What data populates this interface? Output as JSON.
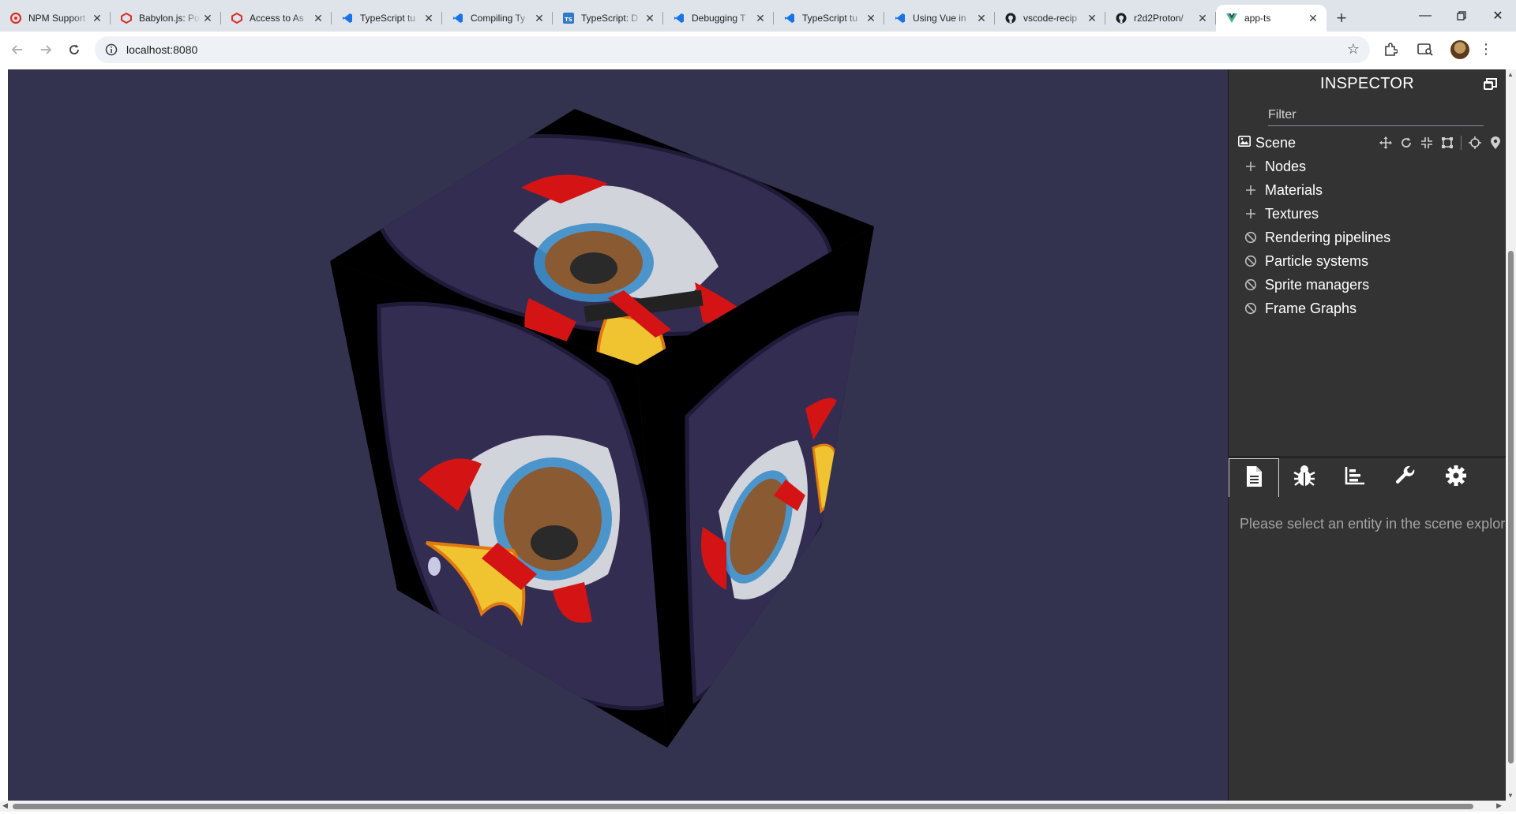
{
  "browser": {
    "tabs": [
      {
        "title": "NPM Support",
        "icon": "npm-icon"
      },
      {
        "title": "Babylon.js: Po",
        "icon": "babylon-icon"
      },
      {
        "title": "Access to As",
        "icon": "babylon-icon"
      },
      {
        "title": "TypeScript tu",
        "icon": "vscode-icon"
      },
      {
        "title": "Compiling Ty",
        "icon": "vscode-icon"
      },
      {
        "title": "TypeScript: D",
        "icon": "typescript-icon"
      },
      {
        "title": "Debugging T",
        "icon": "vscode-icon"
      },
      {
        "title": "TypeScript tu",
        "icon": "vscode-icon"
      },
      {
        "title": "Using Vue in",
        "icon": "vscode-icon"
      },
      {
        "title": "vscode-recip",
        "icon": "github-icon"
      },
      {
        "title": "r2d2Proton/",
        "icon": "github-icon"
      },
      {
        "title": "app-ts",
        "icon": "vue-icon",
        "active": true
      }
    ],
    "url": "localhost:8080",
    "accent": "#1a73e8"
  },
  "inspector": {
    "title": "INSPECTOR",
    "filter_placeholder": "Filter",
    "scene_label": "Scene",
    "tree": [
      {
        "label": "Nodes",
        "icon": "plus-icon"
      },
      {
        "label": "Materials",
        "icon": "plus-icon"
      },
      {
        "label": "Textures",
        "icon": "plus-icon"
      },
      {
        "label": "Rendering pipelines",
        "icon": "ban-icon"
      },
      {
        "label": "Particle systems",
        "icon": "ban-icon"
      },
      {
        "label": "Sprite managers",
        "icon": "ban-icon"
      },
      {
        "label": "Frame Graphs",
        "icon": "ban-icon"
      }
    ],
    "pane_tabs": [
      "properties-icon",
      "debug-bug-icon",
      "statistics-icon",
      "tools-wrench-icon",
      "settings-gear-icon"
    ],
    "pane_message": "Please select an entity in the scene explorer.",
    "colors": {
      "background": "#333333",
      "canvas": "#333350"
    }
  }
}
